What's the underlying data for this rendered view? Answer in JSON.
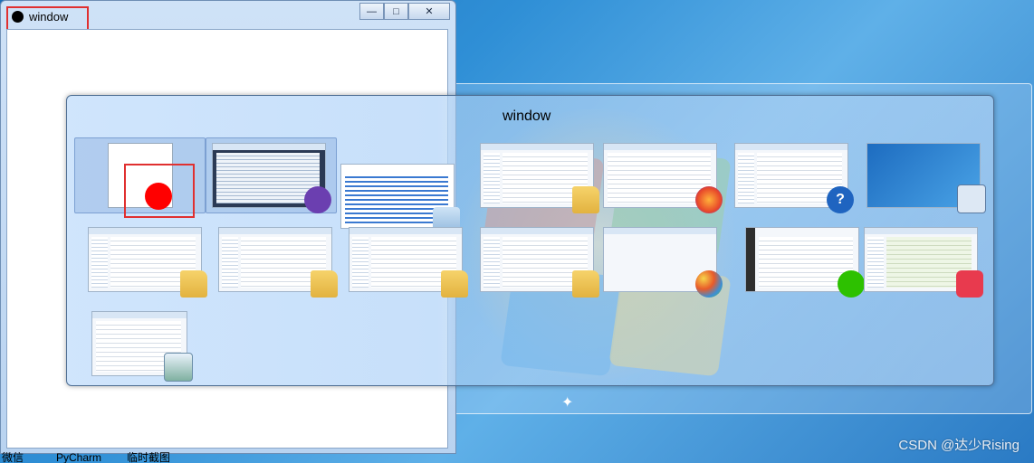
{
  "app_window": {
    "title": "window",
    "controls": {
      "minimize": "—",
      "maximize": "□",
      "close": "✕"
    }
  },
  "switcher": {
    "title": "window",
    "thumbnails": [
      {
        "id": "t1",
        "label": "window",
        "icon": "red-dot"
      },
      {
        "id": "t2",
        "label": "",
        "icon": "visual-studio-icon"
      },
      {
        "id": "t3",
        "label": "",
        "icon": "notepad-icon"
      },
      {
        "id": "t4",
        "label": "",
        "icon": "folder-icon"
      },
      {
        "id": "t5",
        "label": "",
        "icon": "firefox-icon"
      },
      {
        "id": "t6",
        "label": "",
        "icon": "help-icon"
      },
      {
        "id": "t7",
        "label": "",
        "icon": "desktop-icon"
      },
      {
        "id": "t8",
        "label": "",
        "icon": "folder-icon"
      },
      {
        "id": "t9",
        "label": "",
        "icon": "folder-icon"
      },
      {
        "id": "t10",
        "label": "",
        "icon": "folder-icon"
      },
      {
        "id": "t11",
        "label": "",
        "icon": "folder-icon"
      },
      {
        "id": "t12",
        "label": "",
        "icon": "paint-icon"
      },
      {
        "id": "t13",
        "label": "",
        "icon": "wechat-icon"
      },
      {
        "id": "t14",
        "label": "",
        "icon": "pdf-icon"
      },
      {
        "id": "t15",
        "label": "",
        "icon": "sheet-icon"
      }
    ]
  },
  "taskbar": {
    "items": [
      "微信",
      "PyCharm",
      "临时截图"
    ]
  },
  "watermark": "CSDN @达少Rising",
  "colors": {
    "highlight_red": "#e03030",
    "dot_red": "#ff0000"
  }
}
